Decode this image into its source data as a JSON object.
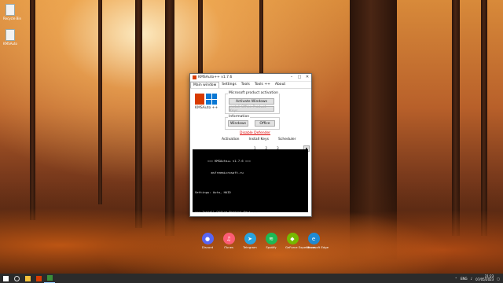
{
  "desktop": {
    "icons": [
      {
        "label": "Recycle Bin"
      },
      {
        "label": "KMSAuto"
      }
    ]
  },
  "window": {
    "title": "KMSAuto++ v1.7.6",
    "menu": [
      "Main window",
      "Settings",
      "Tools",
      "Tools ++",
      "About"
    ],
    "logo_label": "KMSAuto ++",
    "product_group": "Microsoft product activation",
    "activate_windows": "Activate Windows",
    "install_office": "Install Office Product Keys",
    "info_group": "Information",
    "btn_windows": "Windows",
    "btn_office": "Office",
    "disable_defender": "Disable Defender",
    "tabs": [
      "Activation",
      "Install Keys",
      "Scheduler"
    ],
    "pager": [
      "1",
      "2",
      "3"
    ],
    "console_lines": [
      "       === KMSAuto++ v1.7.6 ===",
      "         msfreemicrosoft.ru",
      "",
      "Settings: Auto, HAID",
      "",
      "=== Install Office Product Keys ..."
    ]
  },
  "dock": [
    {
      "label": "Discord",
      "color": "#5865f2",
      "glyph": "●"
    },
    {
      "label": "iTunes",
      "color": "#fb5c74",
      "glyph": "♫"
    },
    {
      "label": "Telegram",
      "color": "#2aa3df",
      "glyph": "➤"
    },
    {
      "label": "Spotify",
      "color": "#1db954",
      "glyph": "≋"
    },
    {
      "label": "GeForce Experience",
      "color": "#76b900",
      "glyph": "◆"
    },
    {
      "label": "Microsoft Edge",
      "color": "#1f8ad2",
      "glyph": "e"
    }
  ],
  "taskbar": {
    "clock_time": "21:23",
    "clock_date": "07/05/2023",
    "lang": "ENG"
  }
}
